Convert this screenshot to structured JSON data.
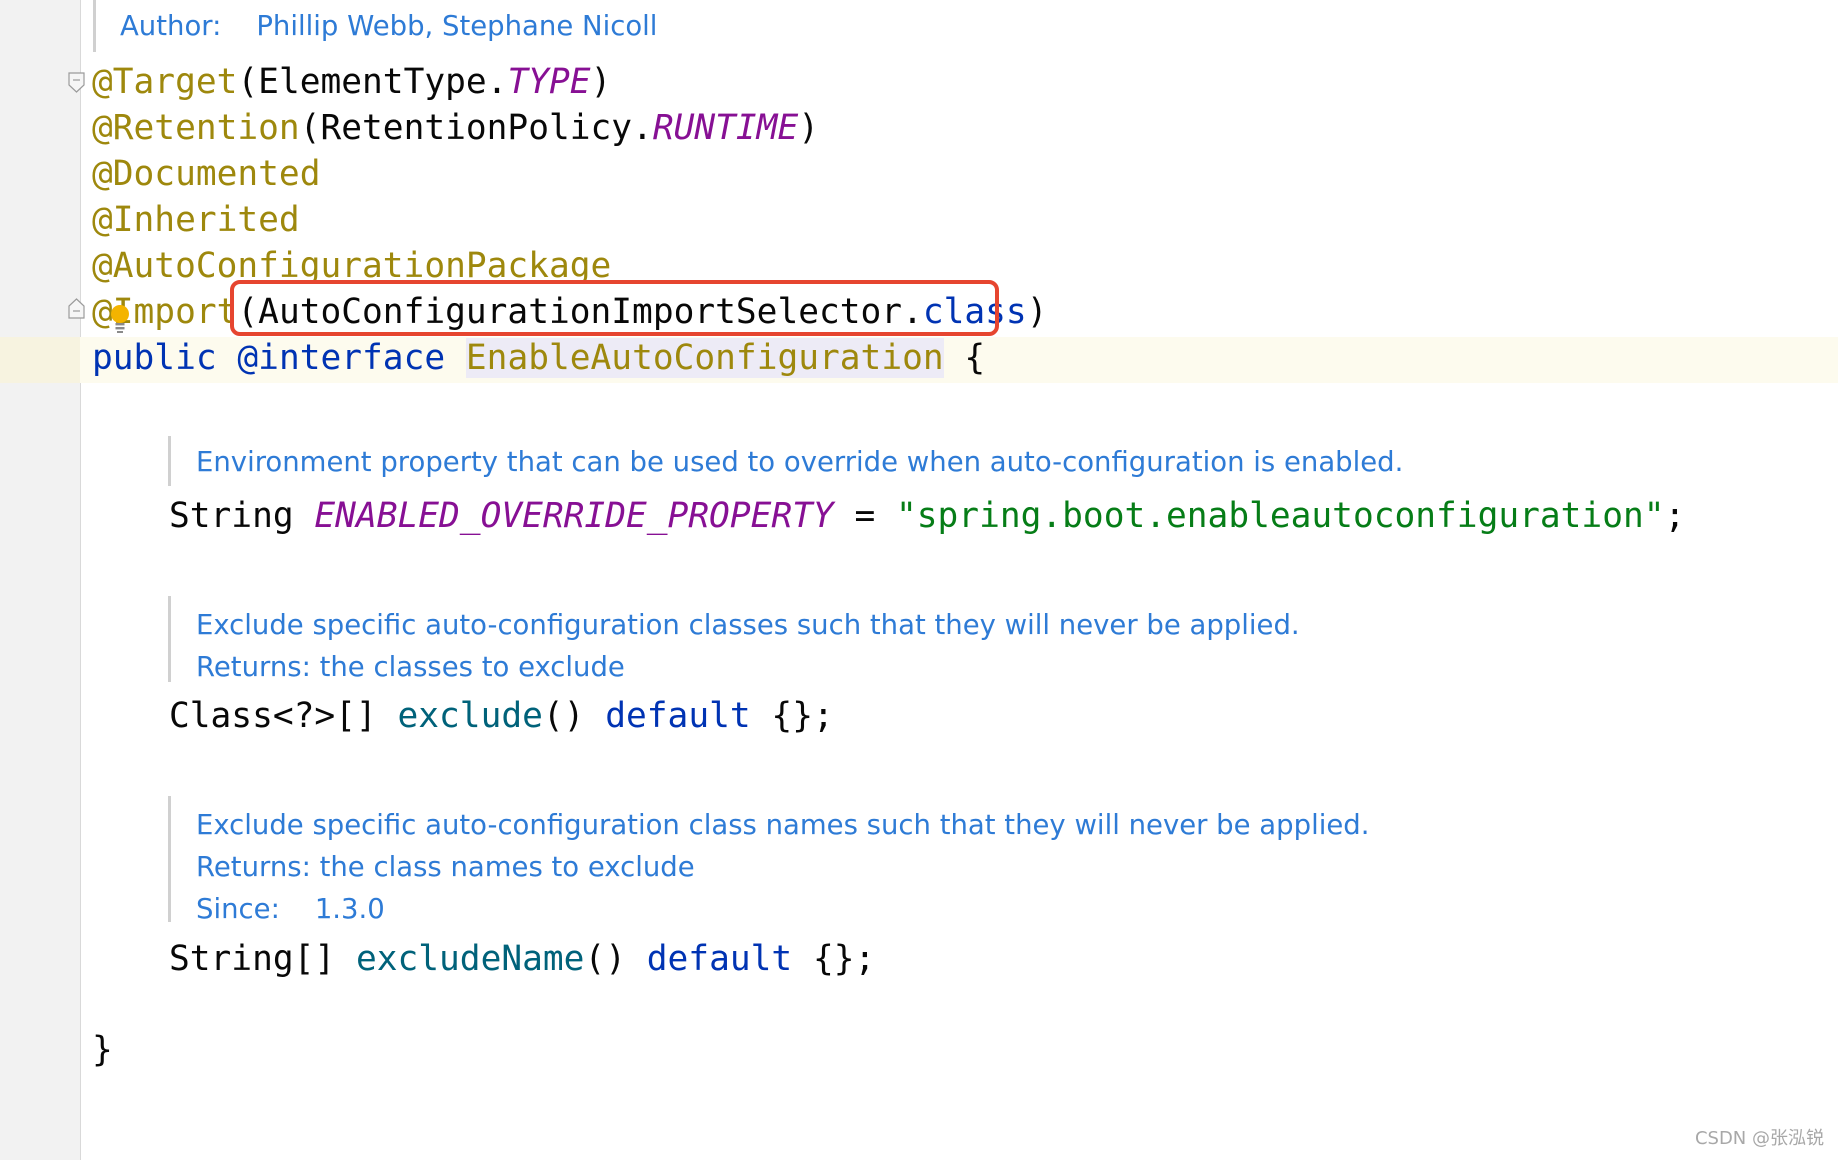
{
  "header_doc": {
    "author_label": "Author:",
    "author_value": "Phillip Webb, Stephane Nicoll"
  },
  "annotations": {
    "target_name": "@Target",
    "target_open": "(ElementType.",
    "target_const": "TYPE",
    "target_close": ")",
    "retention_name": "@Retention",
    "retention_open": "(RetentionPolicy.",
    "retention_const": "RUNTIME",
    "retention_close": ")",
    "documented": "@Documented",
    "inherited": "@Inherited",
    "auto_config_package": "@AutoConfigurationPackage",
    "import_name": "@Import",
    "import_open": "(AutoConfigurationImportSelector.",
    "import_class_kw": "class",
    "import_close": ")"
  },
  "declaration": {
    "public_kw": "public",
    "interface_kw": "@interface",
    "name": "EnableAutoConfiguration",
    "open_brace": "{"
  },
  "field1": {
    "doc": "Environment property that can be used to override when auto-configuration is enabled.",
    "type": "String",
    "name": "ENABLED_OVERRIDE_PROPERTY",
    "equals": " = ",
    "value": "\"spring.boot.enableautoconfiguration\"",
    "semicolon": ";"
  },
  "method1": {
    "doc": "Exclude specific auto-configuration classes such that they will never be applied.",
    "returns": "Returns: the classes to exclude",
    "type": "Class<?>[]",
    "name": "exclude",
    "parens": "()",
    "default_kw": "default",
    "default_val": "{};"
  },
  "method2": {
    "doc": "Exclude specific auto-configuration class names such that they will never be applied.",
    "returns": "Returns: the class names to exclude",
    "since_label": "Since:",
    "since_value": "1.3.0",
    "type": "String[]",
    "name": "excludeName",
    "parens": "()",
    "default_kw": "default",
    "default_val": "{};"
  },
  "closing_brace": "}",
  "watermark": "CSDN @张泓锐",
  "colors": {
    "annotation": "#9e880d",
    "keyword": "#0033b3",
    "constant": "#871094",
    "string": "#067d17",
    "method": "#00627a",
    "doc": "#2e7bd6",
    "highlight_box": "#e6452f"
  }
}
